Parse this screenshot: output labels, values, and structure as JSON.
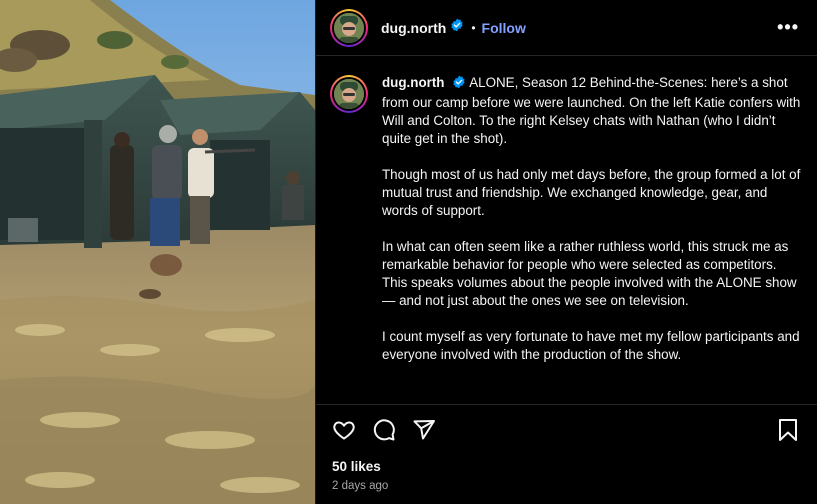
{
  "post": {
    "username": "dug.north",
    "verified_icon": "verified-badge-icon",
    "separator": "•",
    "follow_label": "Follow",
    "more_icon": "more-options-icon",
    "more_glyph": "•••"
  },
  "caption": {
    "username": "dug.north",
    "paragraphs": [
      "ALONE, Season 12 Behind-the-Scenes: here’s a shot from our camp before we were launched. On the left Katie confers with Will and Colton. To the right Kelsey chats with Nathan (who I didn’t quite get in the shot).",
      "Though most of us had only met days before, the group formed a lot of mutual trust and friendship. We exchanged knowledge, gear, and words of support.",
      "In what can often seem like a rather ruthless world, this struck me as remarkable behavior for people who were selected as competitors. This speaks volumes about the people involved with the ALONE show— and not just about the ones we see on television.",
      "I count myself as very fortunate to have met my fellow participants and everyone involved with the production of the show."
    ]
  },
  "actions": {
    "like_icon": "heart-icon",
    "comment_icon": "comment-icon",
    "share_icon": "share-icon",
    "save_icon": "bookmark-icon"
  },
  "stats": {
    "likes": "50 likes",
    "time": "2 days ago"
  },
  "colors": {
    "background": "#000000",
    "link_blue": "#85a1ff",
    "verified_blue": "#0095f6",
    "muted": "#a8a8a8"
  }
}
